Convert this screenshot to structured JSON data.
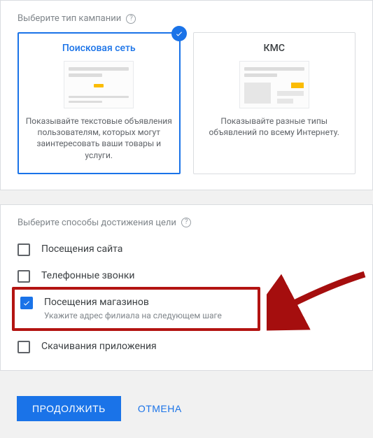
{
  "campaign_type": {
    "label": "Выберите тип кампании",
    "options": [
      {
        "id": "search",
        "title": "Поисковая сеть",
        "desc": "Показывайте текстовые объявления пользователям, которых могут заинтересовать ваши товары и услуги.",
        "selected": true
      },
      {
        "id": "kms",
        "title": "КМС",
        "desc": "Показывайте разные типы объявлений по всему Интернету.",
        "selected": false
      }
    ]
  },
  "goals": {
    "label": "Выберите способы достижения цели",
    "items": [
      {
        "label": "Посещения сайта",
        "checked": false
      },
      {
        "label": "Телефонные звонки",
        "checked": false
      },
      {
        "label": "Посещения магазинов",
        "checked": true,
        "sub": "Укажите адрес филиала на следующем шаге"
      },
      {
        "label": "Скачивания приложения",
        "checked": false
      }
    ]
  },
  "footer": {
    "continue": "ПРОДОЛЖИТЬ",
    "cancel": "ОТМЕНА"
  }
}
